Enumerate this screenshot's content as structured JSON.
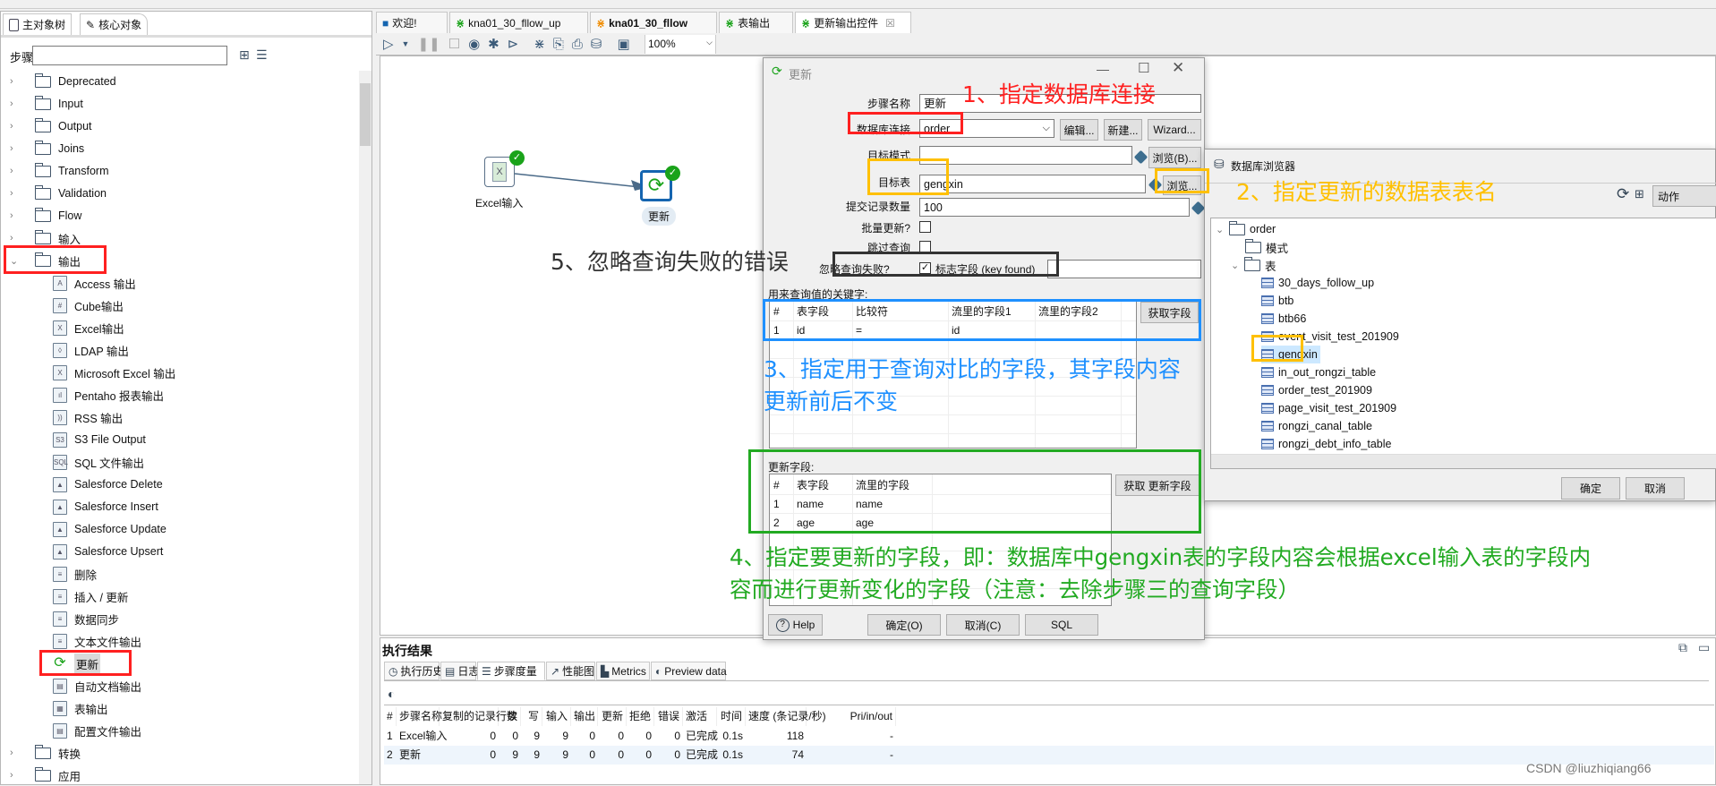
{
  "colors": {
    "annotation_red": "#ff2020",
    "annotation_orange": "#ffc000",
    "annotation_blue": "#1e90ff",
    "annotation_green": "#22aa22",
    "annotation_dark": "#333333",
    "selection": "#cce8ff",
    "success": "#1aa31a"
  },
  "left_panel": {
    "tabs": [
      {
        "label": "主对象树",
        "icon": "document-search-icon"
      },
      {
        "label": "核心对象",
        "icon": "pencil-icon"
      }
    ],
    "search_label": "步骤",
    "search_value": "",
    "tree": [
      {
        "label": "Deprecated",
        "type": "folder",
        "expanded": false
      },
      {
        "label": "Input",
        "type": "folder",
        "expanded": false
      },
      {
        "label": "Output",
        "type": "folder",
        "expanded": false
      },
      {
        "label": "Joins",
        "type": "folder",
        "expanded": false
      },
      {
        "label": "Transform",
        "type": "folder",
        "expanded": false
      },
      {
        "label": "Validation",
        "type": "folder",
        "expanded": false
      },
      {
        "label": "Flow",
        "type": "folder",
        "expanded": false
      },
      {
        "label": "输入",
        "type": "folder",
        "expanded": false
      },
      {
        "label": "输出",
        "type": "folder",
        "expanded": true
      },
      {
        "label": "Access 输出",
        "type": "step",
        "glyph": "A"
      },
      {
        "label": "Cube输出",
        "type": "step",
        "glyph": "#"
      },
      {
        "label": "Excel输出",
        "type": "step",
        "glyph": "X"
      },
      {
        "label": "LDAP 输出",
        "type": "step",
        "glyph": "◊"
      },
      {
        "label": "Microsoft Excel 输出",
        "type": "step",
        "glyph": "X"
      },
      {
        "label": "Pentaho 报表输出",
        "type": "step",
        "glyph": "ıl"
      },
      {
        "label": "RSS 输出",
        "type": "step",
        "glyph": "))"
      },
      {
        "label": "S3 File Output",
        "type": "step",
        "glyph": "S3"
      },
      {
        "label": "SQL 文件输出",
        "type": "step",
        "glyph": "SQL"
      },
      {
        "label": "Salesforce Delete",
        "type": "step",
        "glyph": "▲"
      },
      {
        "label": "Salesforce Insert",
        "type": "step",
        "glyph": "▲"
      },
      {
        "label": "Salesforce Update",
        "type": "step",
        "glyph": "▲"
      },
      {
        "label": "Salesforce Upsert",
        "type": "step",
        "glyph": "▲"
      },
      {
        "label": "删除",
        "type": "step",
        "glyph": "≡"
      },
      {
        "label": "插入 / 更新",
        "type": "step",
        "glyph": "≡"
      },
      {
        "label": "数据同步",
        "type": "step",
        "glyph": "≡"
      },
      {
        "label": "文本文件输出",
        "type": "step",
        "glyph": "≡"
      },
      {
        "label": "更新",
        "type": "step",
        "glyph": "⟳",
        "selected": true
      },
      {
        "label": "自动文档输出",
        "type": "step",
        "glyph": "▤"
      },
      {
        "label": "表输出",
        "type": "step",
        "glyph": "▦"
      },
      {
        "label": "配置文件输出",
        "type": "step",
        "glyph": "▤"
      },
      {
        "label": "转换",
        "type": "folder",
        "expanded": false
      },
      {
        "label": "应用",
        "type": "folder",
        "expanded": false
      }
    ]
  },
  "editor_tabs": [
    {
      "label": "欢迎!",
      "icon": "welcome-icon"
    },
    {
      "label": "kna01_30_fllow_up",
      "icon": "transformation-icon"
    },
    {
      "label": "kna01_30_fllow",
      "icon": "job-icon",
      "bold": true
    },
    {
      "label": "表输出",
      "icon": "transformation-icon"
    },
    {
      "label": "更新输出控件",
      "icon": "transformation-icon",
      "active": true,
      "closable": true
    }
  ],
  "toolbar": {
    "zoom": "100%"
  },
  "canvas": {
    "steps": [
      {
        "label": "Excel输入",
        "status": "ok"
      },
      {
        "label": "更新",
        "status": "ok"
      }
    ]
  },
  "update_dialog": {
    "title": "更新",
    "step_name_label": "步骤名称",
    "step_name": "更新",
    "connection_label": "数据库连接",
    "connection": "order",
    "edit_btn": "编辑...",
    "new_btn": "新建...",
    "wizard_btn": "Wizard...",
    "schema_label": "目标模式",
    "schema": "",
    "browse_schema_btn": "浏览(B)...",
    "table_label": "目标表",
    "table": "gengxin",
    "browse_table_btn": "浏览...",
    "commit_label": "提交记录数量",
    "commit": "100",
    "batch_label": "批量更新?",
    "batch": false,
    "skip_label": "跳过查询",
    "skip": false,
    "ignore_label": "忽略查询失败?",
    "ignore": true,
    "flag_label": "标志字段 (key found)",
    "flag_value": "",
    "keys_label": "用来查询值的关键字:",
    "keys_headers": [
      "#",
      "表字段",
      "比较符",
      "流里的字段1",
      "流里的字段2"
    ],
    "keys_rows": [
      [
        "1",
        "id",
        "=",
        "id",
        ""
      ]
    ],
    "get_fields_btn": "获取字段",
    "update_label": "更新字段:",
    "update_headers": [
      "#",
      "表字段",
      "流里的字段"
    ],
    "update_rows": [
      [
        "1",
        "name",
        "name"
      ],
      [
        "2",
        "age",
        "age"
      ]
    ],
    "get_update_btn": "获取 更新字段",
    "help_btn": "Help",
    "ok_btn": "确定(O)",
    "cancel_btn": "取消(C)",
    "sql_btn": "SQL"
  },
  "db_browser": {
    "title": "数据库浏览器",
    "action_btn": "动作",
    "root": "order",
    "schema_folder": "模式",
    "tables_folder": "表",
    "tables": [
      "30_days_follow_up",
      "btb",
      "btb66",
      "event_visit_test_201909",
      "gengxin",
      "in_out_rongzi_table",
      "order_test_201909",
      "page_visit_test_201909",
      "rongzi_canal_table",
      "rongzi_debt_info_table"
    ],
    "selected": "gengxin",
    "ok_btn": "确定",
    "cancel_btn": "取消"
  },
  "results": {
    "title": "执行结果",
    "tabs": [
      {
        "label": "执行历史",
        "icon": "clock-icon"
      },
      {
        "label": "日志",
        "icon": "log-icon"
      },
      {
        "label": "步骤度量",
        "icon": "list-icon",
        "active": true
      },
      {
        "label": "性能图",
        "icon": "chart-icon"
      },
      {
        "label": "Metrics",
        "icon": "metrics-icon"
      },
      {
        "label": "Preview data",
        "icon": "eye-icon"
      }
    ],
    "headers": [
      "#",
      "步骤名称",
      "复制的记录行数",
      "读",
      "写",
      "输入",
      "输出",
      "更新",
      "拒绝",
      "错误",
      "激活",
      "时间",
      "速度 (条记录/秒)",
      "Pri/in/out"
    ],
    "rows": [
      [
        "1",
        "Excel输入",
        "0",
        "0",
        "9",
        "9",
        "0",
        "0",
        "0",
        "0",
        "已完成",
        "0.1s",
        "118",
        "-"
      ],
      [
        "2",
        "更新",
        "0",
        "9",
        "9",
        "9",
        "0",
        "0",
        "0",
        "0",
        "已完成",
        "0.1s",
        "74",
        "-"
      ]
    ]
  },
  "annotations": {
    "a1": "1、指定数据库连接",
    "a2": "2、指定更新的数据表表名",
    "a3_line1": "3、指定用于查询对比的字段，其字段内容",
    "a3_line2": "更新前后不变",
    "a4_line1": "4、指定要更新的字段，即：数据库中gengxin表的字段内容会根据excel输入表的字段内",
    "a4_line2": "容而进行更新变化的字段（注意：去除步骤三的查询字段）",
    "a5": "5、忽略查询失败的错误"
  },
  "watermark": "CSDN @liuzhiqiang66"
}
